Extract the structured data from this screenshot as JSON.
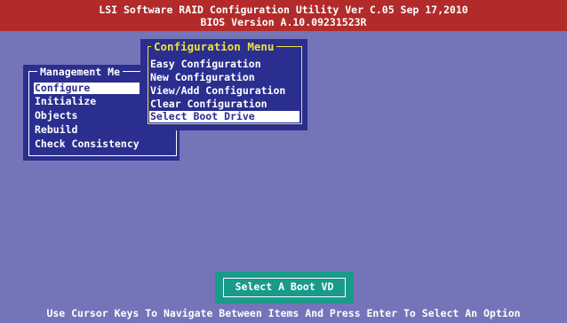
{
  "header": {
    "title": "LSI Software RAID Configuration Utility Ver C.05 Sep 17,2010",
    "bios_version": "BIOS Version   A.10.09231523R"
  },
  "management_menu": {
    "title": "Management Me",
    "items": [
      "Configure",
      "Initialize",
      "Objects",
      "Rebuild",
      "Check Consistency"
    ],
    "selected_index": 0
  },
  "configuration_menu": {
    "title": "Configuration Menu",
    "items": [
      "Easy Configuration",
      "New Configuration",
      "View/Add Configuration",
      "Clear Configuration",
      "Select Boot Drive"
    ],
    "selected_index": 4
  },
  "status_box": {
    "label": "Select A Boot VD"
  },
  "footer": {
    "hint": "Use Cursor Keys To Navigate Between Items And Press Enter To Select An Option"
  },
  "colors": {
    "background": "#7474b8",
    "menu_bg": "#2a2e8e",
    "header_bg": "#b22a2a",
    "highlight_title": "#f0e040",
    "status_bg": "#1a9a8a"
  }
}
